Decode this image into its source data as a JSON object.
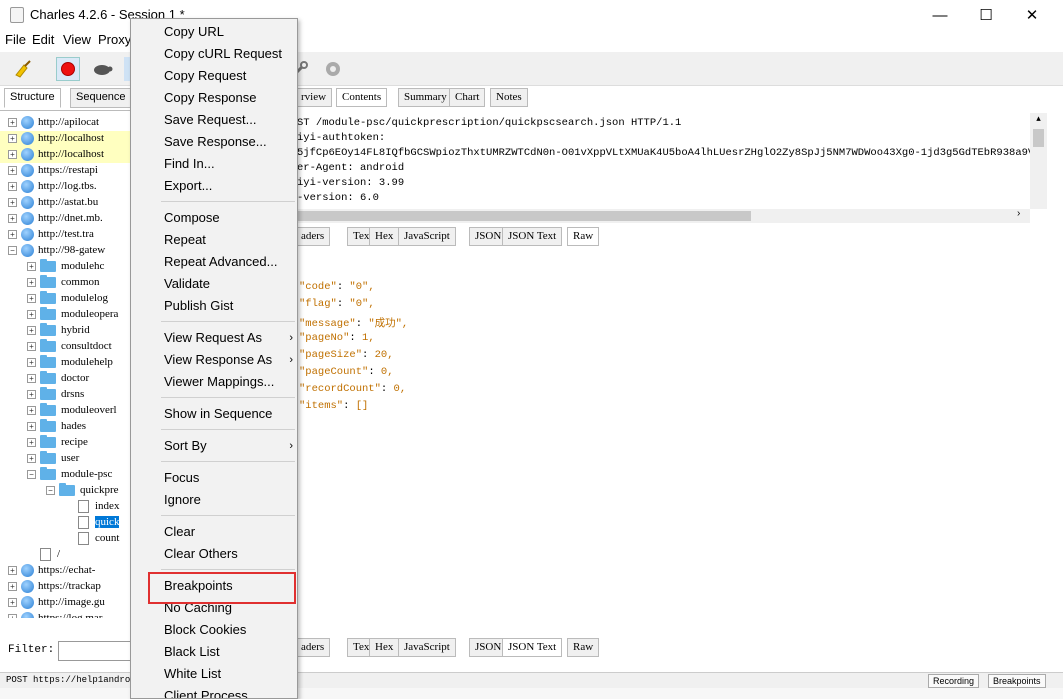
{
  "window": {
    "title": "Charles 4.2.6 - Session 1 *",
    "minimize": "—",
    "maximize": "☐",
    "close": "✕"
  },
  "menubar": {
    "items": [
      "File",
      "Edit",
      "View",
      "Proxy"
    ]
  },
  "left": {
    "tabs": [
      "Structure",
      "Sequence"
    ],
    "tree": [
      {
        "text": "http://apilocat",
        "type": "host",
        "level": 0,
        "exp": "+"
      },
      {
        "text": "http://localhost",
        "type": "host",
        "level": 0,
        "exp": "+",
        "hl": true
      },
      {
        "text": "http://localhost",
        "type": "host",
        "level": 0,
        "exp": "+",
        "hl": true
      },
      {
        "text": "https://restapi",
        "type": "host",
        "level": 0,
        "exp": "+"
      },
      {
        "text": "http://log.tbs.",
        "type": "host",
        "level": 0,
        "exp": "+"
      },
      {
        "text": "http://astat.bu",
        "type": "host",
        "level": 0,
        "exp": "+"
      },
      {
        "text": "http://dnet.mb.",
        "type": "host",
        "level": 0,
        "exp": "+"
      },
      {
        "text": "http://test.tra",
        "type": "host",
        "level": 0,
        "exp": "+"
      },
      {
        "text": "http://98-gatew",
        "type": "host",
        "level": 0,
        "exp": "−"
      },
      {
        "text": "modulehc",
        "type": "folder",
        "level": 1,
        "exp": "+"
      },
      {
        "text": "common",
        "type": "folder",
        "level": 1,
        "exp": "+"
      },
      {
        "text": "modulelog",
        "type": "folder",
        "level": 1,
        "exp": "+"
      },
      {
        "text": "moduleopera",
        "type": "folder",
        "level": 1,
        "exp": "+"
      },
      {
        "text": "hybrid",
        "type": "folder",
        "level": 1,
        "exp": "+"
      },
      {
        "text": "consultdoct",
        "type": "folder",
        "level": 1,
        "exp": "+"
      },
      {
        "text": "modulehelp",
        "type": "folder",
        "level": 1,
        "exp": "+"
      },
      {
        "text": "doctor",
        "type": "folder",
        "level": 1,
        "exp": "+"
      },
      {
        "text": "drsns",
        "type": "folder",
        "level": 1,
        "exp": "+"
      },
      {
        "text": "moduleoverl",
        "type": "folder",
        "level": 1,
        "exp": "+"
      },
      {
        "text": "hades",
        "type": "folder",
        "level": 1,
        "exp": "+"
      },
      {
        "text": "recipe",
        "type": "folder",
        "level": 1,
        "exp": "+"
      },
      {
        "text": "user",
        "type": "folder",
        "level": 1,
        "exp": "+"
      },
      {
        "text": "module-psc",
        "type": "folder",
        "level": 1,
        "exp": "−"
      },
      {
        "text": "quickpre",
        "type": "folder",
        "level": 2,
        "exp": "−"
      },
      {
        "text": "index",
        "type": "file",
        "level": 3
      },
      {
        "text": "quick",
        "type": "file",
        "level": 3,
        "sel": true
      },
      {
        "text": "count",
        "type": "file",
        "level": 3
      },
      {
        "text": "/",
        "type": "file",
        "level": 1
      },
      {
        "text": "https://echat-",
        "type": "host",
        "level": 0,
        "exp": "+"
      },
      {
        "text": "https://trackap",
        "type": "host",
        "level": 0,
        "exp": "+"
      },
      {
        "text": "http://image.gu",
        "type": "host",
        "level": 0,
        "exp": "+"
      },
      {
        "text": "https://log.mar",
        "type": "host",
        "level": 0,
        "exp": "+"
      }
    ],
    "filter_label": "Filter:"
  },
  "right": {
    "top_tabs": [
      "Overview",
      "Contents",
      "Summary",
      "Chart",
      "Notes"
    ],
    "request_lines": [
      "ST /module-psc/quickprescription/quickpscsearch.json HTTP/1.1",
      "iyi-authtoken:",
      "5jfCp6EOy14FL8IQfbGCSWpiozThxtUMRZWTCdN0n-O01vXppVLtXMUaK4U5boA4lhLUesrZHglO2Zy8SpJj5NM7WDWoo43Xg0-1jd3g5GdTEbR938a9VYJCv3",
      "er-Agent: android",
      "iyi-version: 3.99",
      "-version: 6.0"
    ],
    "req_tabs": [
      "aders",
      "Text",
      "Hex",
      "JavaScript",
      "JSON",
      "JSON Text",
      "Raw"
    ],
    "json_lines": [
      {
        "k": "\"code\"",
        "v": "\"0\","
      },
      {
        "k": "\"flag\"",
        "v": "\"0\","
      },
      {
        "k": "\"message\"",
        "v": "\"成功\","
      },
      {
        "k": "\"pageNo\"",
        "v": "1,"
      },
      {
        "k": "\"pageSize\"",
        "v": "20,"
      },
      {
        "k": "\"pageCount\"",
        "v": "0,"
      },
      {
        "k": "\"recordCount\"",
        "v": "0,"
      },
      {
        "k": "\"items\"",
        "v": "[]"
      }
    ],
    "resp_tabs": [
      "aders",
      "Text",
      "Hex",
      "JavaScript",
      "JSON",
      "JSON Text",
      "Raw"
    ]
  },
  "context_menu": {
    "items": [
      {
        "label": "Copy URL"
      },
      {
        "label": "Copy cURL Request"
      },
      {
        "label": "Copy Request"
      },
      {
        "label": "Copy Response"
      },
      {
        "label": "Save Request..."
      },
      {
        "label": "Save Response..."
      },
      {
        "label": "Find In..."
      },
      {
        "label": "Export..."
      },
      {
        "sep": true
      },
      {
        "label": "Compose"
      },
      {
        "label": "Repeat"
      },
      {
        "label": "Repeat Advanced..."
      },
      {
        "label": "Validate"
      },
      {
        "label": "Publish Gist"
      },
      {
        "sep": true
      },
      {
        "label": "View Request As",
        "sub": true
      },
      {
        "label": "View Response As",
        "sub": true
      },
      {
        "label": "Viewer Mappings..."
      },
      {
        "sep": true
      },
      {
        "label": "Show in Sequence"
      },
      {
        "sep": true
      },
      {
        "label": "Sort By",
        "sub": true
      },
      {
        "sep": true
      },
      {
        "label": "Focus"
      },
      {
        "label": "Ignore"
      },
      {
        "sep": true
      },
      {
        "label": "Clear"
      },
      {
        "label": "Clear Others"
      },
      {
        "sep": true
      },
      {
        "label": "Breakpoints",
        "highlight": true
      },
      {
        "label": "No Caching"
      },
      {
        "label": "Block Cookies"
      },
      {
        "label": "Black List"
      },
      {
        "label": "White List"
      },
      {
        "label": "Client Process"
      }
    ]
  },
  "status": {
    "left": "POST https://help1andro:",
    "recording": "Recording",
    "breakpoints": "Breakpoints"
  },
  "colors": {
    "highlight_box": "#e03030",
    "selection": "#0078d7"
  }
}
